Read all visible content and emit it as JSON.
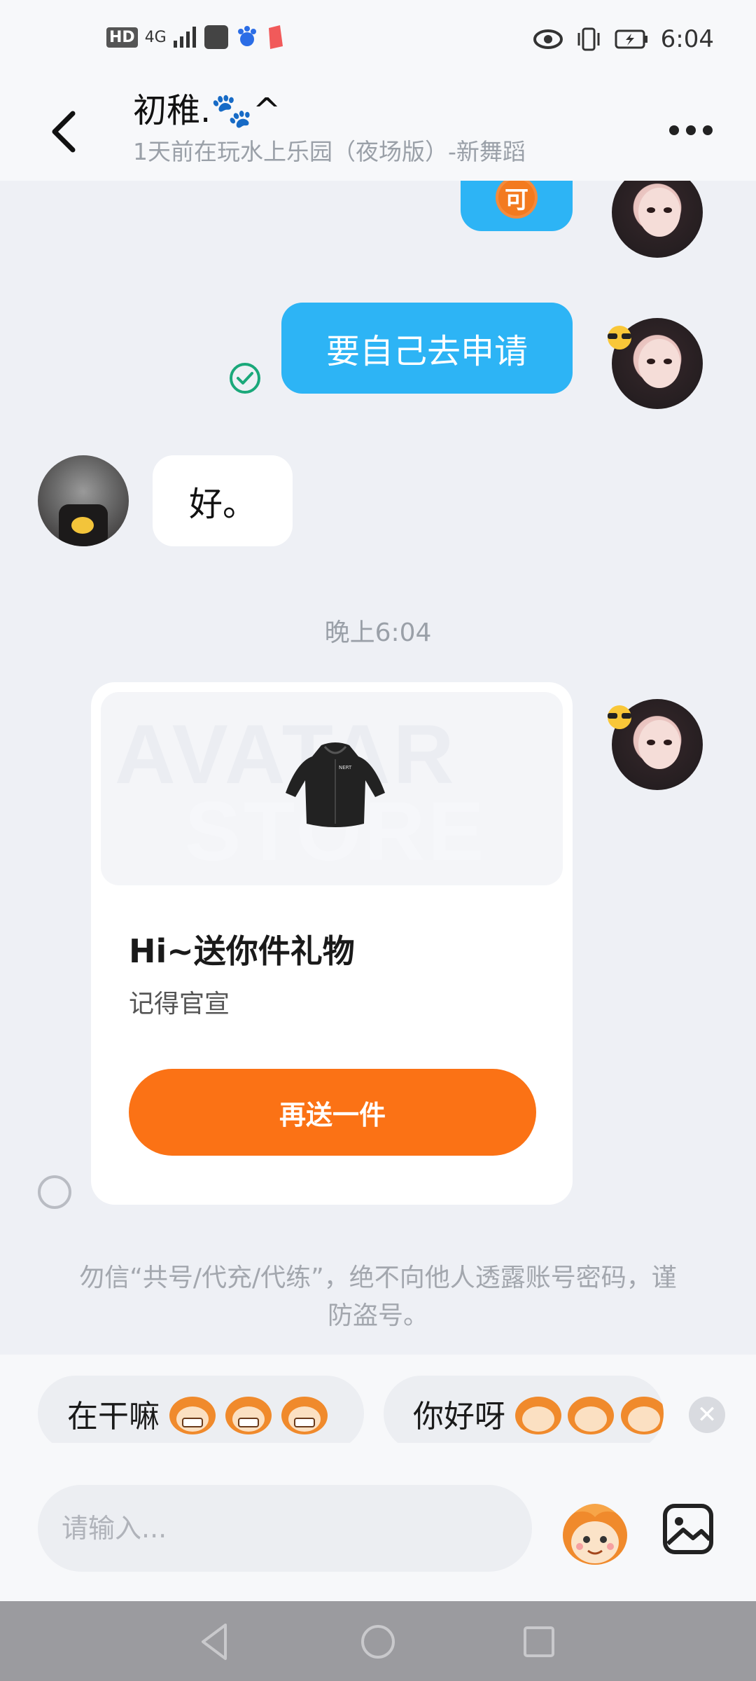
{
  "status_bar": {
    "network": "4G",
    "hd": "HD",
    "time": "6:04"
  },
  "header": {
    "title": "初稚.🐾^",
    "subtitle": "1天前在玩水上乐园（夜场版）-新舞蹈"
  },
  "messages": {
    "sent_1": "可",
    "sent_2": "要自己去申请",
    "received_1": "好。",
    "timestamp": "晚上6:04"
  },
  "gift_card": {
    "watermark_1": "AVATAR",
    "watermark_2": "STORE",
    "title": "Hi~送你件礼物",
    "subtitle": "记得官宣",
    "button": "再送一件"
  },
  "warning": "勿信“共号/代充/代练”，绝不向他人透露账号密码，谨防盗号。",
  "quick_replies": [
    {
      "text": "在干嘛"
    },
    {
      "text": "你好呀"
    }
  ],
  "input": {
    "placeholder": "请输入..."
  },
  "colors": {
    "sent_bubble": "#2db4f5",
    "gift_button": "#fb7215",
    "check": "#1aa87a"
  }
}
